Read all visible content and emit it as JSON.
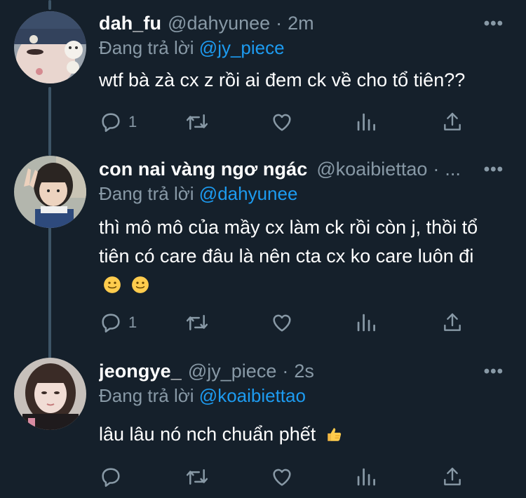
{
  "reply_prefix": "Đang trả lời",
  "tweets": [
    {
      "display_name": "dah_fu",
      "handle": "@dahyunee",
      "separator": "·",
      "time": "2m",
      "reply_to": "@jy_piece",
      "text": "wtf bà zà cx z rồi ai đem ck về cho tổ tiên??",
      "reply_count": "1",
      "more": "•••"
    },
    {
      "display_name": "con nai vàng ngơ ngác",
      "handle": "@koaibiettao",
      "separator": "·",
      "time": "...",
      "reply_to": "@dahyunee",
      "text": "thì mô mô của mầy cx làm ck rồi còn j, thồi tổ tiên có care đâu là nên cta cx ko care luôn đi",
      "emojis": [
        "slightly-smiling-face",
        "slightly-smiling-face"
      ],
      "reply_count": "1",
      "more": "•••"
    },
    {
      "display_name": "jeongye_",
      "handle": "@jy_piece",
      "separator": "·",
      "time": "2s",
      "reply_to": "@koaibiettao",
      "text": "lâu lâu nó nch chuẩn phết",
      "emojis": [
        "thumbs-up"
      ],
      "reply_count": "",
      "more": "•••"
    }
  ],
  "colors": {
    "background": "#15202b",
    "primary_text": "#ffffff",
    "secondary_text": "#8899a6",
    "accent": "#1d9bf0",
    "thread_line": "#3d5466"
  }
}
